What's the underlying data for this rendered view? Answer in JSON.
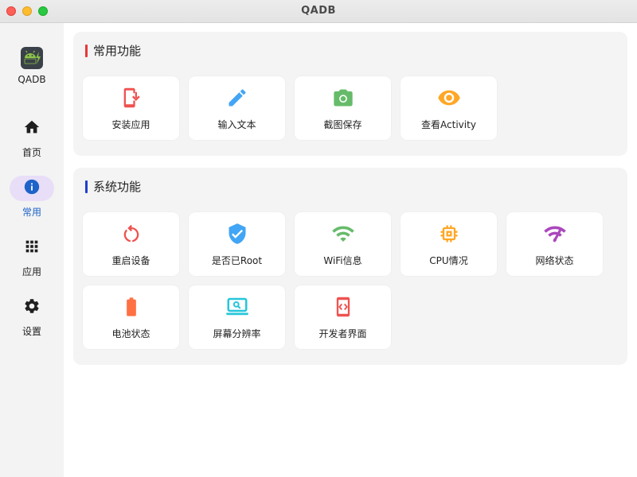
{
  "window": {
    "title": "QADB"
  },
  "sidebar": {
    "app_name": "QADB",
    "items": [
      {
        "label": "首页",
        "icon": "home-icon",
        "active": false
      },
      {
        "label": "常用",
        "icon": "info-icon",
        "active": true
      },
      {
        "label": "应用",
        "icon": "apps-grid-icon",
        "active": false
      },
      {
        "label": "设置",
        "icon": "gear-icon",
        "active": false
      }
    ]
  },
  "sections": {
    "common": {
      "title": "常用功能",
      "accent": "#e53935",
      "items": [
        {
          "label": "安装应用",
          "icon": "install-app-icon",
          "color": "#ef5350"
        },
        {
          "label": "输入文本",
          "icon": "pencil-icon",
          "color": "#42a5f5"
        },
        {
          "label": "截图保存",
          "icon": "camera-icon",
          "color": "#66bb6a"
        },
        {
          "label": "查看Activity",
          "icon": "eye-icon",
          "color": "#ffa726"
        }
      ]
    },
    "system": {
      "title": "系统功能",
      "accent": "#1e3fd0",
      "items": [
        {
          "label": "重启设备",
          "icon": "restart-icon",
          "color": "#ef5350"
        },
        {
          "label": "是否已Root",
          "icon": "shield-check-icon",
          "color": "#42a5f5"
        },
        {
          "label": "WiFi信息",
          "icon": "wifi-icon",
          "color": "#66bb6a"
        },
        {
          "label": "CPU情况",
          "icon": "cpu-icon",
          "color": "#ffa726"
        },
        {
          "label": "网络状态",
          "icon": "network-signal-icon",
          "color": "#ab47bc"
        },
        {
          "label": "电池状态",
          "icon": "battery-icon",
          "color": "#ff7043"
        },
        {
          "label": "屏幕分辨率",
          "icon": "screen-search-icon",
          "color": "#26c6da"
        },
        {
          "label": "开发者界面",
          "icon": "developer-mode-icon",
          "color": "#ef5350"
        }
      ]
    }
  }
}
